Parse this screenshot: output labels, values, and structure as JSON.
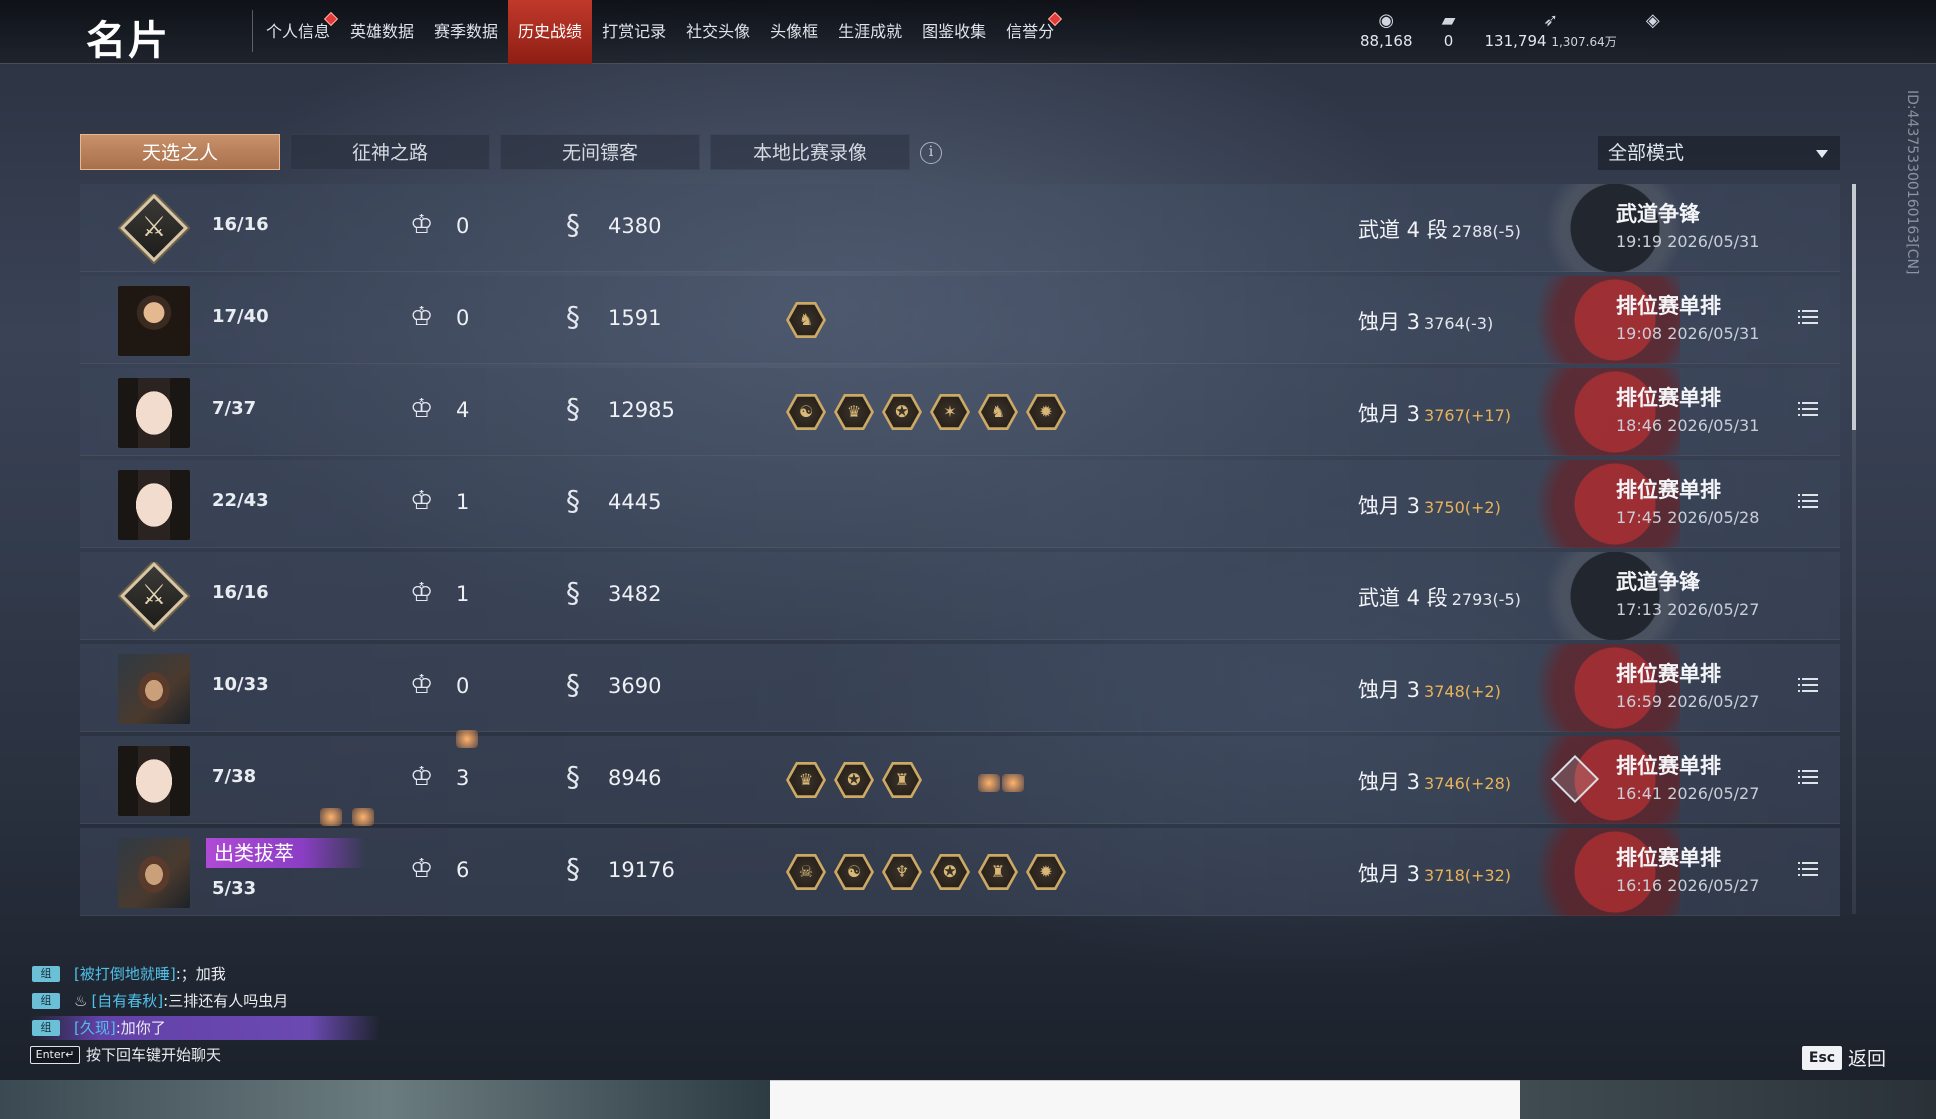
{
  "header": {
    "title": "名片",
    "nav": [
      {
        "label": "个人信息",
        "dot": true,
        "active": false
      },
      {
        "label": "英雄数据",
        "dot": false,
        "active": false
      },
      {
        "label": "赛季数据",
        "dot": false,
        "active": false
      },
      {
        "label": "历史战绩",
        "dot": false,
        "active": true
      },
      {
        "label": "打赏记录",
        "dot": false,
        "active": false
      },
      {
        "label": "社交头像",
        "dot": false,
        "active": false
      },
      {
        "label": "头像框",
        "dot": false,
        "active": false
      },
      {
        "label": "生涯成就",
        "dot": false,
        "active": false
      },
      {
        "label": "图鉴收集",
        "dot": false,
        "active": false
      },
      {
        "label": "信誉分",
        "dot": true,
        "active": false
      }
    ],
    "currencies": [
      {
        "icon": "coin-icon",
        "value": "88,168",
        "extra": ""
      },
      {
        "icon": "ticket-icon",
        "value": "0",
        "extra": ""
      },
      {
        "icon": "feather-icon",
        "value": "131,794",
        "extra": "1,307.64万"
      },
      {
        "icon": "gem-icon",
        "value": "",
        "extra": ""
      }
    ]
  },
  "tabs": [
    {
      "label": "天选之人",
      "active": true
    },
    {
      "label": "征神之路",
      "active": false
    },
    {
      "label": "无间镖客",
      "active": false
    },
    {
      "label": "本地比赛录像",
      "active": false
    }
  ],
  "mode_filter": {
    "selected": "全部模式"
  },
  "player_id": "ID:4437533001601​63[CN]",
  "records": [
    {
      "avatar": "emblem",
      "kd": "16/16",
      "mvp": "0",
      "score": "4380",
      "achievements": [],
      "rank": "武道 4 段",
      "elo": "2788(-5)",
      "elo_up": false,
      "rank_style": "grey",
      "mode": "武道争锋",
      "time": "19:19  2026/05/31",
      "detail": false,
      "badge": ""
    },
    {
      "avatar": "male",
      "kd": "17/40",
      "mvp": "0",
      "score": "1591",
      "achievements": [
        "♞"
      ],
      "rank": "蚀月 3",
      "elo": "3764(-3)",
      "elo_up": false,
      "rank_style": "red",
      "mode": "排位赛单排",
      "time": "19:08  2026/05/31",
      "detail": true,
      "badge": ""
    },
    {
      "avatar": "female",
      "kd": "7/37",
      "mvp": "4",
      "score": "12985",
      "achievements": [
        "☯",
        "♛",
        "✪",
        "✶",
        "♞",
        "✹"
      ],
      "rank": "蚀月 3",
      "elo": "3767(+17)",
      "elo_up": true,
      "rank_style": "red",
      "mode": "排位赛单排",
      "time": "18:46  2026/05/31",
      "detail": true,
      "badge": ""
    },
    {
      "avatar": "female",
      "kd": "22/43",
      "mvp": "1",
      "score": "4445",
      "achievements": [],
      "rank": "蚀月 3",
      "elo": "3750(+2)",
      "elo_up": true,
      "rank_style": "red",
      "mode": "排位赛单排",
      "time": "17:45  2026/05/28",
      "detail": true,
      "badge": ""
    },
    {
      "avatar": "emblem",
      "kd": "16/16",
      "mvp": "1",
      "score": "3482",
      "achievements": [],
      "rank": "武道 4 段",
      "elo": "2793(-5)",
      "elo_up": false,
      "rank_style": "grey",
      "mode": "武道争锋",
      "time": "17:13  2026/05/27",
      "detail": false,
      "badge": ""
    },
    {
      "avatar": "masked",
      "kd": "10/33",
      "mvp": "0",
      "score": "3690",
      "achievements": [],
      "rank": "蚀月 3",
      "elo": "3748(+2)",
      "elo_up": true,
      "rank_style": "red",
      "mode": "排位赛单排",
      "time": "16:59  2026/05/27",
      "detail": true,
      "badge": ""
    },
    {
      "avatar": "female",
      "kd": "7/38",
      "mvp": "3",
      "score": "8946",
      "achievements": [
        "♛",
        "✪",
        "♜"
      ],
      "rank": "蚀月 3",
      "elo": "3746(+28)",
      "elo_up": true,
      "rank_style": "red",
      "mode": "排位赛单排",
      "time": "16:41  2026/05/27",
      "detail": true,
      "badge": ""
    },
    {
      "avatar": "masked",
      "kd": "5/33",
      "mvp": "6",
      "score": "19176",
      "achievements": [
        "☠",
        "☯",
        "♆",
        "✪",
        "♜",
        "✹"
      ],
      "rank": "蚀月 3",
      "elo": "3718(+32)",
      "elo_up": true,
      "rank_style": "red",
      "mode": "排位赛单排",
      "time": "16:16  2026/05/27",
      "detail": true,
      "badge": "出类拔萃"
    }
  ],
  "chat": {
    "lines": [
      {
        "tag": "组",
        "who": "[被打倒地就睡]",
        "msg": ":；加我",
        "crest": "",
        "highlight": false
      },
      {
        "tag": "组",
        "who": "[自有春秋]",
        "msg": ":三排还有人吗虫月",
        "crest": "♨",
        "highlight": false
      },
      {
        "tag": "组",
        "who": "[久现]",
        "msg": ":加你了",
        "crest": "",
        "highlight": true
      }
    ],
    "hint_key": "Enter↵",
    "hint": "按下回车键开始聊天"
  },
  "footer": {
    "esc_key": "Esc",
    "back_label": "返回"
  },
  "colors": {
    "accent_red": "#c0392b",
    "tab_active": "#c9916a",
    "elo_gain": "#e8b35a",
    "chat_name": "#4fc0e8"
  }
}
